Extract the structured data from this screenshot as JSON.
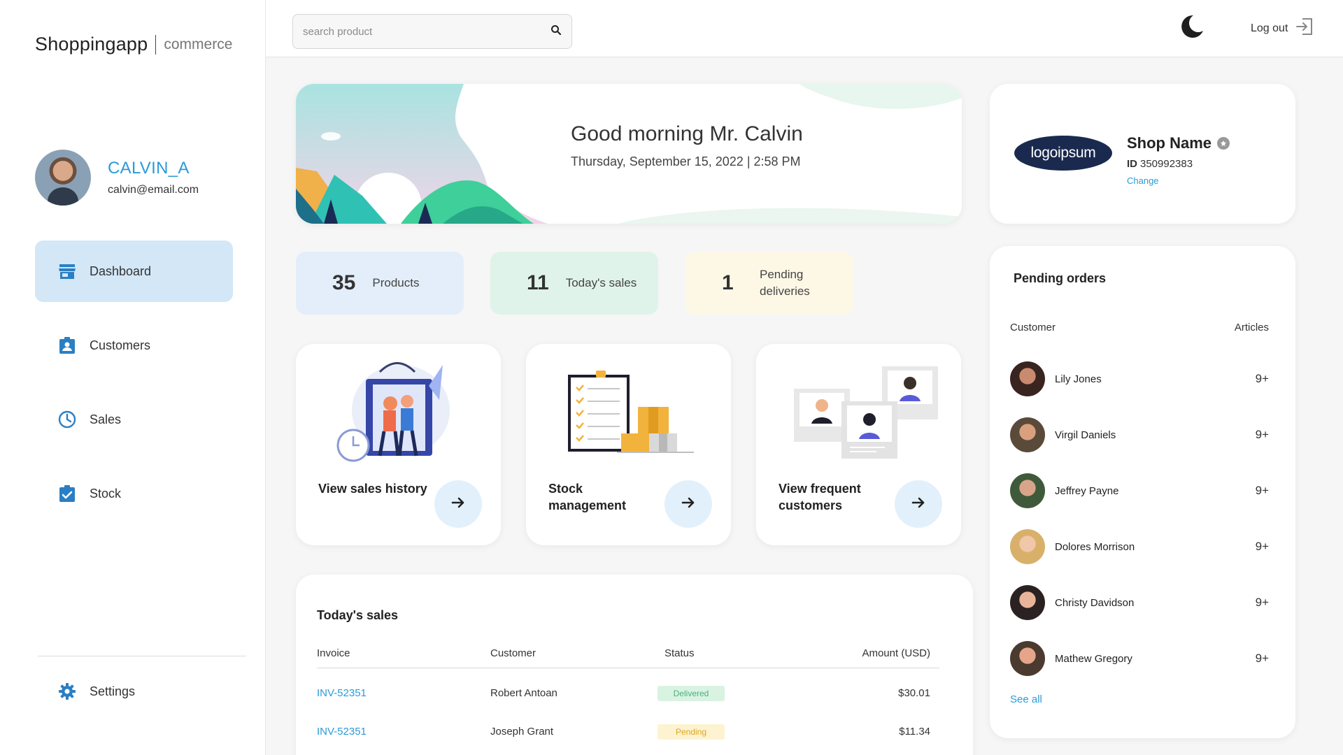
{
  "brand": {
    "name": "Shoppingapp",
    "sub": "commerce"
  },
  "profile": {
    "username": "CALVIN_A",
    "email": "calvin@email.com"
  },
  "nav": {
    "items": [
      {
        "label": "Dashboard",
        "icon": "store-icon",
        "active": true
      },
      {
        "label": "Customers",
        "icon": "badge-icon",
        "active": false
      },
      {
        "label": "Sales",
        "icon": "clock-icon",
        "active": false
      },
      {
        "label": "Stock",
        "icon": "clipboard-check-icon",
        "active": false
      }
    ],
    "settings": {
      "label": "Settings",
      "icon": "gear-icon"
    }
  },
  "topbar": {
    "search_placeholder": "search product",
    "logout_label": "Log out"
  },
  "greeting": {
    "title": "Good morning Mr. Calvin",
    "date": "Thursday, September 15, 2022 | 2:58 PM"
  },
  "shop": {
    "logo_text": "logoipsum",
    "name": "Shop Name",
    "id_label": "ID",
    "id_value": "350992383",
    "change_label": "Change"
  },
  "stats": [
    {
      "value": "35",
      "label": "Products",
      "color": "#e3eefa"
    },
    {
      "value": "11",
      "label": "Today's sales",
      "color": "#e0f3ea"
    },
    {
      "value": "1",
      "label": "Pending deliveries",
      "color": "#fdf8e6"
    }
  ],
  "features": [
    {
      "label": "View sales history"
    },
    {
      "label": "Stock management"
    },
    {
      "label": "View frequent customers"
    }
  ],
  "sales": {
    "title": "Today's sales",
    "columns": [
      "Invoice",
      "Customer",
      "Status",
      "Amount (USD)"
    ],
    "rows": [
      {
        "invoice": "INV-52351",
        "customer": "Robert Antoan",
        "status": "Delivered",
        "amount": "$30.01"
      },
      {
        "invoice": "INV-52351",
        "customer": "Joseph Grant",
        "status": "Pending",
        "amount": "$11.34"
      }
    ]
  },
  "orders": {
    "title": "Pending orders",
    "col_customer": "Customer",
    "col_articles": "Articles",
    "rows": [
      {
        "name": "Lily Jones",
        "count": "9+"
      },
      {
        "name": "Virgil Daniels",
        "count": "9+"
      },
      {
        "name": "Jeffrey Payne",
        "count": "9+"
      },
      {
        "name": "Dolores Morrison",
        "count": "9+"
      },
      {
        "name": "Christy Davidson",
        "count": "9+"
      },
      {
        "name": "Mathew Gregory",
        "count": "9+"
      }
    ],
    "see_all": "See all"
  },
  "colors": {
    "accent": "#2a9bd8",
    "active_nav": "#d3e7f7",
    "arrow_bg": "#e2f0fb"
  }
}
